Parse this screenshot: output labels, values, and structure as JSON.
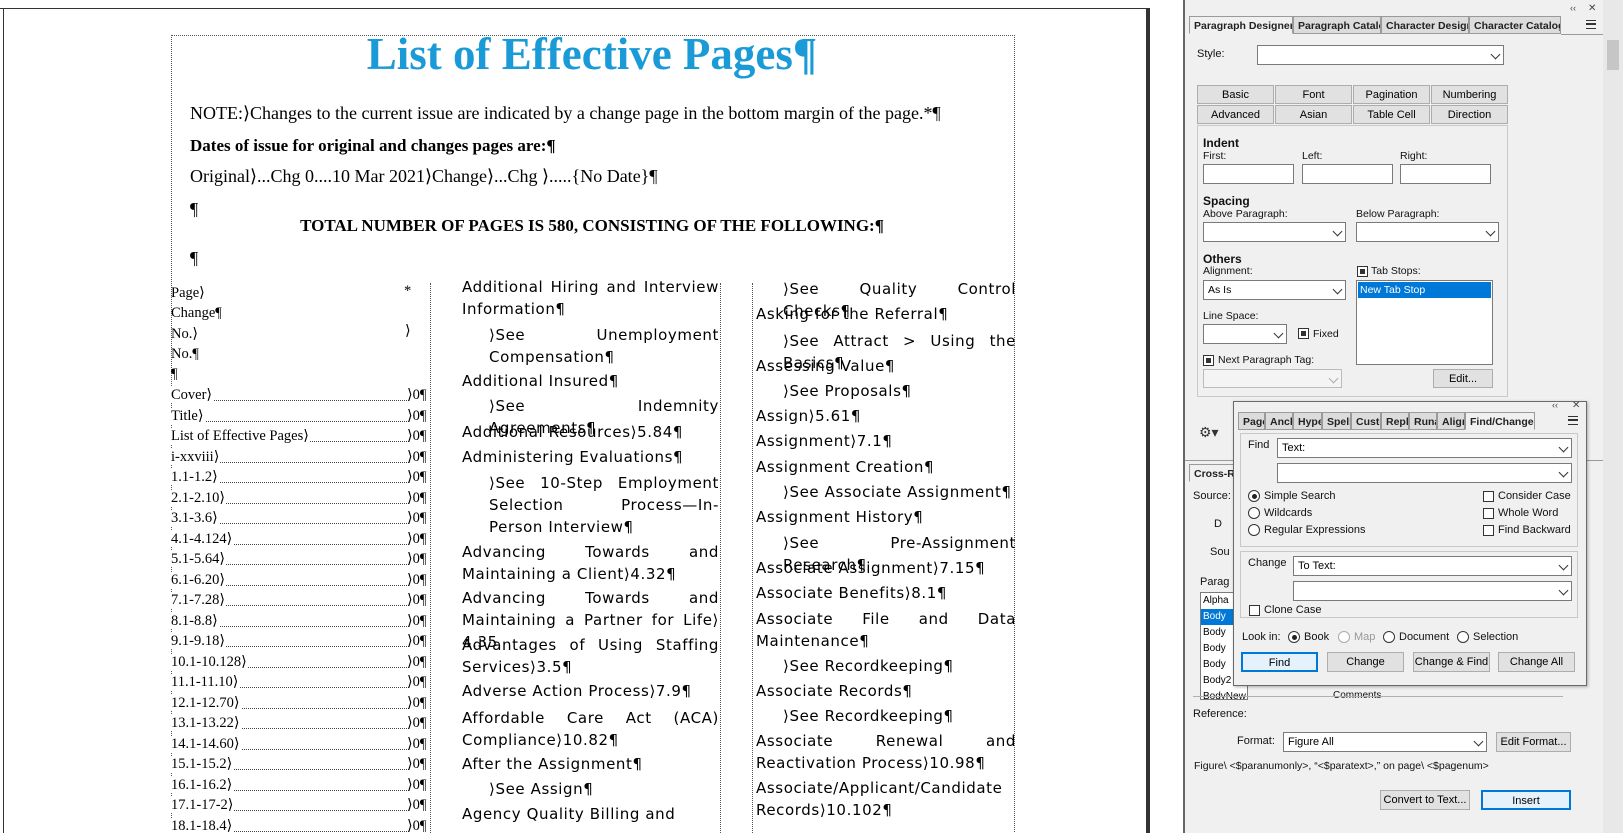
{
  "document": {
    "title": "List of Effective Pages¶",
    "note": "NOTE:⟩Changes to the current issue are indicated by a change page in the bottom margin of the page.*¶",
    "dates_heading": "Dates of issue for original and changes pages are:¶",
    "original_line": "Original⟩...Chg 0....10 Mar 2021⟩Change⟩...Chg ⟩.....{No Date}¶",
    "pilcrow1": "¶",
    "total_heading": "TOTAL NUMBER OF PAGES IS 580, CONSISTING OF THE FOLLOWING:¶",
    "pilcrow2": "¶",
    "left_column": {
      "header_lines": [
        "Page⟩",
        "Change¶",
        "No.⟩",
        "No.¶",
        "¶"
      ],
      "header_star": "*",
      "header_tab": "⟩",
      "rows": [
        {
          "label": "Cover⟩",
          "value": "⟩0¶"
        },
        {
          "label": "Title⟩",
          "value": "⟩0¶"
        },
        {
          "label": "List of Effective Pages⟩",
          "value": "⟩0¶"
        },
        {
          "label": "i-xxviii⟩",
          "value": "⟩0¶"
        },
        {
          "label": "1.1-1.2⟩",
          "value": "⟩0¶"
        },
        {
          "label": "2.1-2.10⟩",
          "value": "⟩0¶"
        },
        {
          "label": "3.1-3.6⟩",
          "value": "⟩0¶"
        },
        {
          "label": "4.1-4.124⟩",
          "value": "⟩0¶"
        },
        {
          "label": "5.1-5.64⟩",
          "value": "⟩0¶"
        },
        {
          "label": "6.1-6.20⟩",
          "value": "⟩0¶"
        },
        {
          "label": "7.1-7.28⟩",
          "value": "⟩0¶"
        },
        {
          "label": "8.1-8.8⟩",
          "value": "⟩0¶"
        },
        {
          "label": "9.1-9.18⟩",
          "value": "⟩0¶"
        },
        {
          "label": "10.1-10.128⟩",
          "value": "⟩0¶"
        },
        {
          "label": "11.1-11.10⟩",
          "value": "⟩0¶"
        },
        {
          "label": "12.1-12.70⟩",
          "value": "⟩0¶"
        },
        {
          "label": "13.1-13.22⟩",
          "value": "⟩0¶"
        },
        {
          "label": "14.1-14.60⟩",
          "value": "⟩0¶"
        },
        {
          "label": "15.1-15.2⟩",
          "value": "⟩0¶"
        },
        {
          "label": "16.1-16.2⟩",
          "value": "⟩0¶"
        },
        {
          "label": "17.1-17-2⟩",
          "value": "⟩0¶"
        },
        {
          "label": "18.1-18.4⟩",
          "value": "⟩0¶"
        }
      ]
    },
    "middle_column": [
      "Additional Hiring and Interview Information¶",
      "⟩See Unemployment Compensation¶",
      "Additional Insured¶",
      "⟩See Indemnity Agreements¶",
      "Additional Resources⟩5.84¶",
      "Administering Evaluations¶",
      "⟩See 10-Step Employment Selection Process—In-Person Interview¶",
      "Advancing Towards and Maintaining a Client⟩4.32¶",
      "Advancing Towards and Maintaining a Partner for Life⟩4.35",
      "Advantages of Using Staffing Services⟩3.5¶",
      "Adverse Action Process⟩7.9¶",
      "Affordable Care Act (ACA) Compliance⟩10.82¶",
      "After the Assignment¶",
      "⟩See Assign¶",
      "Agency Quality Billing and"
    ],
    "right_column": [
      "⟩See Quality Control Checks¶",
      "Asking for the Referral¶",
      "⟩See Attract > Using the Basics¶",
      "Assessing Value¶",
      "⟩See Proposals¶",
      "Assign⟩5.61¶",
      "Assignment⟩7.1¶",
      "Assignment Creation¶",
      "⟩See Associate Assignment¶",
      "Assignment History¶",
      "⟩See Pre-Assignment Research¶",
      "Associate Assignment⟩7.15¶",
      "Associate Benefits⟩8.1¶",
      "Associate File and Data Maintenance¶",
      "⟩See Recordkeeping¶",
      "Associate Records¶",
      "⟩See Recordkeeping¶",
      "Associate Renewal and Reactivation Process⟩10.98¶",
      "Associate/Applicant/Candidate Records⟩10.102¶"
    ]
  },
  "paragraph_designer": {
    "tabs": [
      "Paragraph Designer",
      "Paragraph Catalog",
      "Character Designer",
      "Character Catalog"
    ],
    "style_label": "Style:",
    "style_value": "",
    "property_tabs": [
      "Basic",
      "Font",
      "Pagination",
      "Numbering",
      "Advanced",
      "Asian",
      "Table Cell",
      "Direction"
    ],
    "indent_heading": "Indent",
    "first_label": "First:",
    "left_label": "Left:",
    "right_label": "Right:",
    "spacing_heading": "Spacing",
    "above_label": "Above Paragraph:",
    "below_label": "Below Paragraph:",
    "others_heading": "Others",
    "alignment_label": "Alignment:",
    "alignment_value": "As Is",
    "tab_stops_label": "Tab Stops:",
    "tab_stops_items": [
      "New Tab Stop"
    ],
    "line_space_label": "Line Space:",
    "fixed_label": "Fixed",
    "next_para_label": "Next Paragraph Tag:",
    "edit_button": "Edit..."
  },
  "cross_ref": {
    "tab_label": "Cross-R",
    "source_label": "Source:",
    "d_label": "D",
    "sou_label": "Sou",
    "parag_label": "Parag",
    "list_items": [
      "Alpha",
      "Body",
      "Body",
      "Body",
      "Body",
      "Body2",
      "BodyNew"
    ],
    "reference_label": "Reference:",
    "format_label": "Format:",
    "format_value": "Figure All",
    "edit_format_button": "Edit Format...",
    "format_string": "Figure\\ <$paranumonly>, “<$paratext>,” on page\\ <$pagenum>",
    "comments_fragment": "Comments",
    "convert_button": "Convert to Text...",
    "insert_button": "Insert"
  },
  "find_change": {
    "tabs": [
      "Page",
      "Anch",
      "Hype",
      "Spell",
      "Custo",
      "Repla",
      "Runa",
      "Align",
      "Find/Change"
    ],
    "find_label": "Find",
    "find_type": "Text:",
    "find_value": "",
    "simple_search": "Simple Search",
    "wildcards": "Wildcards",
    "regex": "Regular Expressions",
    "consider_case": "Consider Case",
    "whole_word": "Whole Word",
    "find_backward": "Find Backward",
    "change_label": "Change",
    "change_type": "To Text:",
    "change_value": "",
    "clone_case": "Clone Case",
    "look_in_label": "Look in:",
    "look_book": "Book",
    "look_map": "Map",
    "look_document": "Document",
    "look_selection": "Selection",
    "btn_find": "Find",
    "btn_change": "Change",
    "btn_change_find": "Change & Find",
    "btn_change_all": "Change All"
  },
  "colors": {
    "title_blue": "#1a9bd7",
    "selection_blue": "#0078d7"
  }
}
